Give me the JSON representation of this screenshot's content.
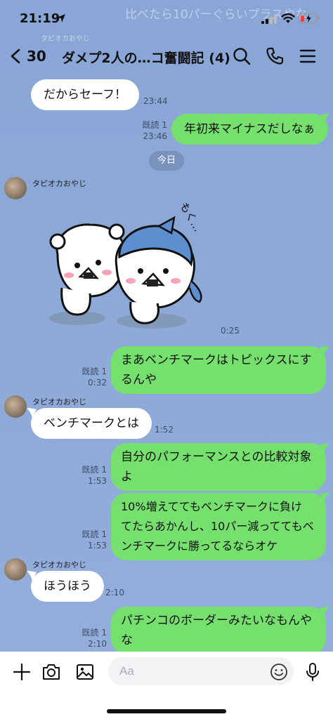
{
  "status_bar": {
    "time": "21:19",
    "background_banner_text": "比べたら10パーぐらいプラスやな",
    "background_banner_sender": "タピオカおやじ"
  },
  "header": {
    "back_count": "30",
    "title": "ダメプ2人の…コ奮闘記 (4)",
    "icons": [
      "search-icon",
      "phone-icon",
      "menu-icon"
    ]
  },
  "messages": [
    {
      "side": "left",
      "text": "だからセーフ！",
      "time": "23:44"
    },
    {
      "side": "right",
      "text": "年初来マイナスだしなぁ",
      "read": "既読 1",
      "time": "23:46"
    },
    {
      "side": "date",
      "text": "今日"
    },
    {
      "side": "left",
      "sender": "タピオカおやじ",
      "type": "sticker",
      "sticker_text": "もく…",
      "time": "0:25"
    },
    {
      "side": "right",
      "lines": [
        "まあベンチマークはトピックスにす",
        "るんや"
      ],
      "read": "既読 1",
      "time": "0:32"
    },
    {
      "side": "left",
      "sender": "タピオカおやじ",
      "text": "ベンチマークとは",
      "time": "1:52"
    },
    {
      "side": "right",
      "lines": [
        "自分のパフォーマンスとの比較対象",
        "よ"
      ],
      "read": "既読 1",
      "time": "1:53"
    },
    {
      "side": "right",
      "lines": [
        "10%増えててもベンチマークに負け",
        "てたらあかんし、10パー減っててもベ",
        "ンチマークに勝ってるならオケ"
      ],
      "read": "既読 1",
      "time": "1:53"
    },
    {
      "side": "left",
      "sender": "タピオカおやじ",
      "text": "ほうほう",
      "time": "2:10"
    },
    {
      "side": "right",
      "lines": [
        "パチンコのボーダーみたいなもんや",
        "な"
      ],
      "read": "既読 1",
      "time": "2:10"
    }
  ],
  "input_bar": {
    "placeholder": "Aa",
    "icons": [
      "plus-icon",
      "camera-icon",
      "image-icon",
      "emoji-icon",
      "microphone-icon"
    ]
  },
  "colors": {
    "chat_background": "#8da9d7",
    "bubble_mine": "#76e06f",
    "bubble_theirs": "#ffffff",
    "battery_low": "#e8453c"
  }
}
